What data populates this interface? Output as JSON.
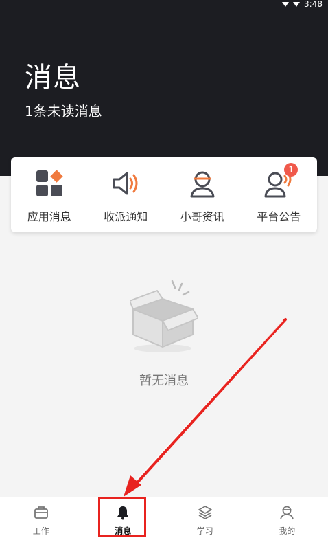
{
  "status": {
    "time": "3:48"
  },
  "header": {
    "title": "消息",
    "subtitle": "1条未读消息"
  },
  "categories": [
    {
      "label": "应用消息",
      "icon": "app-grid-icon"
    },
    {
      "label": "收派通知",
      "icon": "speaker-icon"
    },
    {
      "label": "小哥资讯",
      "icon": "courier-icon"
    },
    {
      "label": "平台公告",
      "icon": "announcement-icon",
      "badge": "1"
    }
  ],
  "empty_state": {
    "text": "暂无消息",
    "icon": "empty-box-icon"
  },
  "tabs": [
    {
      "label": "工作",
      "icon": "briefcase-icon"
    },
    {
      "label": "消息",
      "icon": "bell-icon",
      "active": true
    },
    {
      "label": "学习",
      "icon": "layers-icon"
    },
    {
      "label": "我的",
      "icon": "user-icon"
    }
  ],
  "colors": {
    "header_bg": "#1c1d22",
    "accent": "#f07a3e",
    "badge": "#f0594b",
    "annotation": "#e8231f"
  }
}
